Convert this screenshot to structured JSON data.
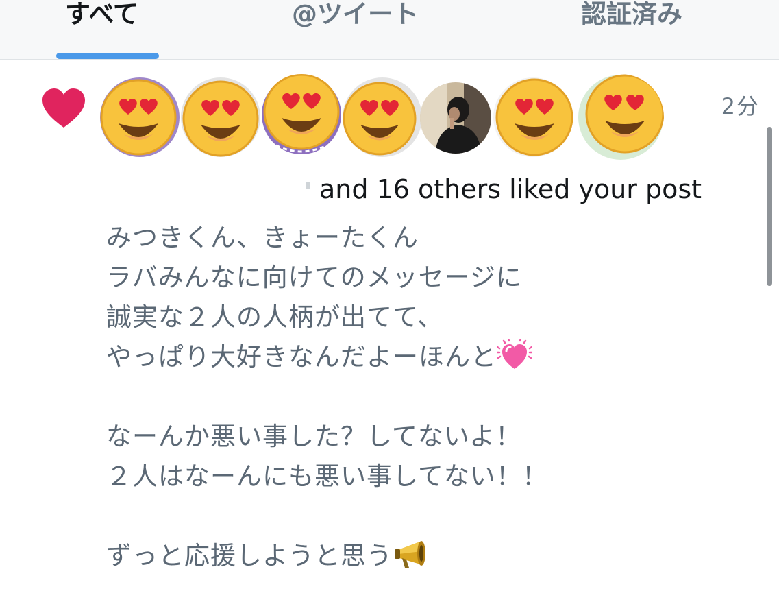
{
  "tabs": {
    "all": "すべて",
    "mentions": "@ツイート",
    "verified": "認証済み"
  },
  "notification": {
    "type_icon": "heart-icon",
    "like_color": "#e0245e",
    "avatars": [
      {
        "kind": "emoji",
        "icon": "heart-eyes-emoji",
        "ring": "#9f87c9"
      },
      {
        "kind": "emoji",
        "icon": "heart-eyes-emoji",
        "ring": "#dddddd"
      },
      {
        "kind": "emoji",
        "icon": "heart-eyes-emoji",
        "ring": "#8d6fbf"
      },
      {
        "kind": "emoji",
        "icon": "heart-eyes-emoji",
        "ring": "#dddddd"
      },
      {
        "kind": "photo",
        "icon": "person-photo"
      },
      {
        "kind": "emoji",
        "icon": "heart-eyes-emoji",
        "ring": "#dddddd"
      },
      {
        "kind": "emoji",
        "icon": "heart-eyes-emoji",
        "ring": "#d8ecd6"
      }
    ],
    "timestamp": "2分",
    "summary": "and 16 others liked your post"
  },
  "post": {
    "lines": [
      "みつきくん、きょーたくん",
      "ラバみんなに向けてのメッセージに",
      "誠実な２人の人柄が出てて、",
      "やっぱり大好きなんだよーほんと",
      "",
      "なーんか悪い事した？してないよ！",
      "２人はなーんにも悪い事してない！！",
      "",
      "ずっと応援しようと思う"
    ],
    "line4_emoji": "growing-heart-emoji",
    "line9_emoji": "megaphone-emoji"
  },
  "colors": {
    "accent": "#4a99e9",
    "text_primary": "#14171a",
    "text_secondary": "#687683"
  }
}
